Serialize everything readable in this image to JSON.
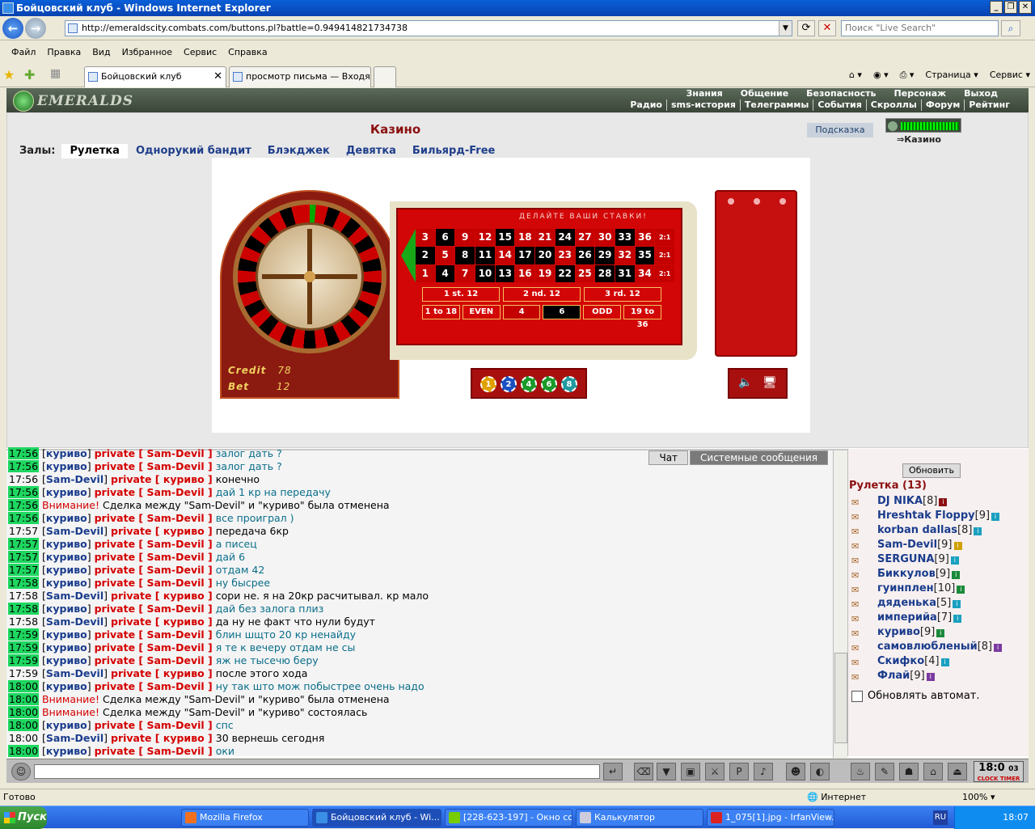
{
  "window": {
    "title": "Бойцовский клуб - Windows Internet Explorer"
  },
  "address": {
    "url": "http://emeraldscity.combats.com/buttons.pl?battle=0.949414821734738",
    "search_placeholder": "Поиск \"Live Search\""
  },
  "menu": [
    "Файл",
    "Правка",
    "Вид",
    "Избранное",
    "Сервис",
    "Справка"
  ],
  "tabs": [
    {
      "label": "Бойцовский клуб"
    },
    {
      "label": "просмотр письма — Входя..."
    }
  ],
  "toolbar_right": {
    "page": "Страница",
    "service": "Сервис"
  },
  "site": {
    "logo": "EMERALDS",
    "nav_top": [
      "Знания",
      "Общение",
      "Безопасность",
      "Персонаж",
      "Выход"
    ],
    "nav_bottom": [
      "Радио",
      "sms-история",
      "Телеграммы",
      "События",
      "Скроллы",
      "Форум",
      "Рейтинг"
    ]
  },
  "casino": {
    "title": "Казино",
    "hint_button": "Подсказка",
    "location": "⇒Казино",
    "halls_label": "Залы:",
    "halls": [
      "Рулетка",
      "Однорукий бандит",
      "Блэкджек",
      "Девятка",
      "Бильярд-Free"
    ],
    "table_hint": "ДЕЛАЙТЕ ВАШИ СТАВКИ!",
    "credit_label": "Credit",
    "credit_value": "78",
    "bet_label": "Bet",
    "bet_value": "12",
    "dozens": [
      "1 st. 12",
      "2 nd. 12",
      "3 rd. 12"
    ],
    "evens": [
      "1 to 18",
      "EVEN",
      "4",
      "6",
      "ODD",
      "19 to 36"
    ],
    "chips": [
      "1",
      "2",
      "4",
      "6",
      "8"
    ]
  },
  "chat": {
    "tabs": [
      "Чат",
      "Системные сообщения"
    ],
    "messages": [
      {
        "time": "17:56",
        "hl": true,
        "from": "куриво",
        "to": "Sam-Devil",
        "text": "залог дать ?",
        "kind": "pm"
      },
      {
        "time": "17:56",
        "hl": true,
        "from": "куриво",
        "to": "Sam-Devil",
        "text": "залог дать ?",
        "kind": "pm"
      },
      {
        "time": "17:56",
        "hl": false,
        "from": "Sam-Devil",
        "to": "куриво",
        "text": "конечно",
        "kind": "pm2"
      },
      {
        "time": "17:56",
        "hl": true,
        "from": "куриво",
        "to": "Sam-Devil",
        "text": "дай 1 кр на передачу",
        "kind": "pm"
      },
      {
        "time": "17:56",
        "hl": true,
        "warn": "Внимание!",
        "text": "Сделка между \"Sam-Devil\" и \"куриво\" была отменена",
        "kind": "sys"
      },
      {
        "time": "17:56",
        "hl": true,
        "from": "куриво",
        "to": "Sam-Devil",
        "text": "все проиграл )",
        "kind": "pm"
      },
      {
        "time": "17:57",
        "hl": false,
        "from": "Sam-Devil",
        "to": "куриво",
        "text": "передача 6кр",
        "kind": "pm2"
      },
      {
        "time": "17:57",
        "hl": true,
        "from": "куриво",
        "to": "Sam-Devil",
        "text": "а писец",
        "kind": "pm"
      },
      {
        "time": "17:57",
        "hl": true,
        "from": "куриво",
        "to": "Sam-Devil",
        "text": "дай 6",
        "kind": "pm"
      },
      {
        "time": "17:57",
        "hl": true,
        "from": "куриво",
        "to": "Sam-Devil",
        "text": "отдам 42",
        "kind": "pm"
      },
      {
        "time": "17:58",
        "hl": true,
        "from": "куриво",
        "to": "Sam-Devil",
        "text": "ну бысрее",
        "kind": "pm"
      },
      {
        "time": "17:58",
        "hl": false,
        "from": "Sam-Devil",
        "to": "куриво",
        "text": "сори не. я на 20кр расчитывал. кр мало",
        "kind": "pm2"
      },
      {
        "time": "17:58",
        "hl": true,
        "from": "куриво",
        "to": "Sam-Devil",
        "text": "дай без залога плиз",
        "kind": "pm"
      },
      {
        "time": "17:58",
        "hl": false,
        "from": "Sam-Devil",
        "to": "куриво",
        "text": "да ну не факт что нули будут",
        "kind": "pm2"
      },
      {
        "time": "17:59",
        "hl": true,
        "from": "куриво",
        "to": "Sam-Devil",
        "text": "блин шщто 20 кр ненайду",
        "kind": "pm"
      },
      {
        "time": "17:59",
        "hl": true,
        "from": "куриво",
        "to": "Sam-Devil",
        "text": "я те к вечеру отдам не сы",
        "kind": "pm"
      },
      {
        "time": "17:59",
        "hl": true,
        "from": "куриво",
        "to": "Sam-Devil",
        "text": "яж не тысечю беру",
        "kind": "pm"
      },
      {
        "time": "17:59",
        "hl": false,
        "from": "Sam-Devil",
        "to": "куриво",
        "text": "после этого хода",
        "kind": "pm2"
      },
      {
        "time": "18:00",
        "hl": true,
        "from": "куриво",
        "to": "Sam-Devil",
        "text": "ну так што мож побыстрее очень надо",
        "kind": "pm"
      },
      {
        "time": "18:00",
        "hl": true,
        "warn": "Внимание!",
        "text": "Сделка между \"Sam-Devil\" и \"куриво\" была отменена",
        "kind": "sys"
      },
      {
        "time": "18:00",
        "hl": true,
        "warn": "Внимание!",
        "text": "Сделка между \"Sam-Devil\" и \"куриво\" состоялась",
        "kind": "sys"
      },
      {
        "time": "18:00",
        "hl": true,
        "from": "куриво",
        "to": "Sam-Devil",
        "text": "спс",
        "kind": "pm"
      },
      {
        "time": "18:00",
        "hl": false,
        "from": "Sam-Devil",
        "to": "куриво",
        "text": "30 вернешь сегодня",
        "kind": "pm2"
      },
      {
        "time": "18:00",
        "hl": true,
        "from": "куриво",
        "to": "Sam-Devil",
        "text": "оки",
        "kind": "pm"
      }
    ]
  },
  "room": {
    "refresh": "Обновить",
    "title": "Рулетка (13)",
    "players": [
      {
        "name": "DJ NIKA",
        "level": "[8]",
        "info": "k"
      },
      {
        "name": "Hreshtak Floppy",
        "level": "[9]",
        "info": "c"
      },
      {
        "name": "korban dallas",
        "level": "[8]",
        "info": "c"
      },
      {
        "name": "Sam-Devil",
        "level": "[9]",
        "info": "y"
      },
      {
        "name": "SERGUNA",
        "level": "[9]",
        "info": "c"
      },
      {
        "name": "Биккулов",
        "level": "[9]",
        "info": "gr"
      },
      {
        "name": "гуинплен",
        "level": "[10]",
        "info": "gr"
      },
      {
        "name": "дяденька",
        "level": "[5]",
        "info": "c"
      },
      {
        "name": "империйа",
        "level": "[7]",
        "info": "c"
      },
      {
        "name": "куриво",
        "level": "[9]",
        "info": "gr"
      },
      {
        "name": "самовлюбленый",
        "level": "[8]",
        "info": "p"
      },
      {
        "name": "Скифко",
        "level": "[4]",
        "info": "c"
      },
      {
        "name": "Флай",
        "level": "[9]",
        "info": "p"
      }
    ],
    "auto_refresh": "Обновлять автомат."
  },
  "clock": {
    "time": "18:0",
    "sub": "CLOCK TIMER",
    "small": "03"
  },
  "status": {
    "left": "Готово",
    "zone": "Интернет",
    "zoom": "100%"
  },
  "taskbar": {
    "start": "Пуск",
    "tasks": [
      "Mozilla Firefox",
      "Бойцовский клуб - Wi...",
      "[228-623-197] - Окно со...",
      "Калькулятор",
      "1_075[1].jpg - IrfanView..."
    ],
    "lang": "RU",
    "time": "18:07"
  }
}
